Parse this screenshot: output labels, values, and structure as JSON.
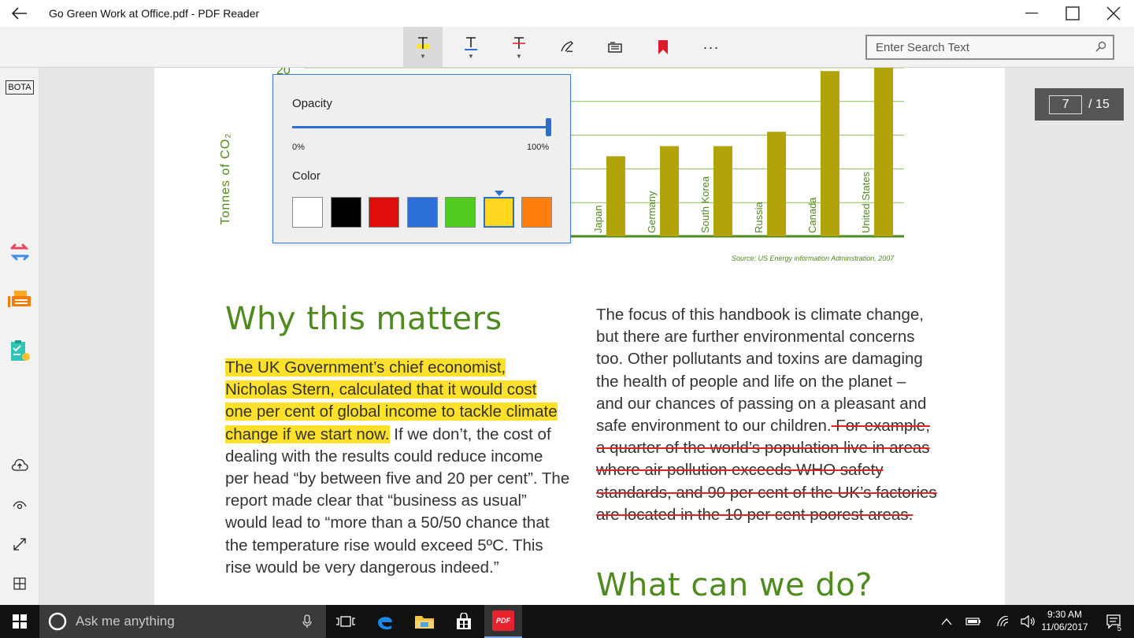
{
  "window": {
    "title": "Go Green Work at Office.pdf - PDF Reader",
    "back_icon": "arrow-left-icon",
    "minimize_icon": "minimize-icon",
    "maximize_icon": "maximize-icon",
    "close_icon": "close-icon"
  },
  "toolbar": {
    "tools": [
      "highlight-text-icon",
      "underline-text-icon",
      "strikeout-text-icon",
      "freehand-pen-icon",
      "stamp-icon",
      "bookmark-icon",
      "more-icon"
    ],
    "search_placeholder": "Enter Search Text"
  },
  "sidebar": {
    "bota_label": "BOTA",
    "items": [
      "convert-icon",
      "fax-icon",
      "clipboard-check-icon",
      "cloud-upload-icon",
      "eye-icon",
      "expand-icon",
      "grid-icon"
    ]
  },
  "page_indicator": {
    "current": "7",
    "total": "/ 15"
  },
  "chart": {
    "ylabel": "Tonnes of CO₂",
    "y_tick_top": "20",
    "source": "Source: US Energy information Adminstration, 2007"
  },
  "chart_data": {
    "type": "bar",
    "categories": [
      "Japan",
      "Germany",
      "South Korea",
      "Russia",
      "Canada",
      "United States"
    ],
    "values": [
      9.5,
      10.7,
      10.7,
      12.4,
      19.6,
      20.1
    ],
    "ylim": [
      0,
      20
    ],
    "ylabel": "Tonnes of CO₂",
    "grid": true
  },
  "popup": {
    "opacity_label": "Opacity",
    "opacity_value": 1.0,
    "min_label": "0%",
    "max_label": "100%",
    "color_label": "Color",
    "colors": [
      "#ffffff",
      "#000000",
      "#e00d0d",
      "#2c6fd6",
      "#52cc1e",
      "#ffd620",
      "#ff7f0e"
    ],
    "selected_color": "#ffd620"
  },
  "content": {
    "heading1": "Why this matters",
    "left_highlight_1": "The UK Government’s chief economist,",
    "left_highlight_2": "Nicholas Stern, calculated that it would cost",
    "left_highlight_3": "one per cent of global income to tackle climate",
    "left_highlight_4": "change if we start now.",
    "left_rest_4": " If we don’t, the cost of",
    "left_5": "dealing with the results could reduce income",
    "left_6": "per head “by between five and 20 per cent”. The",
    "left_7": "report made clear that “business as usual”",
    "left_8": "would lead to “more than a 50/50 chance that",
    "left_9": "the temperature rise would exceed 5ºC. This",
    "left_10": "rise would be very dangerous indeed.”",
    "right_1": "The focus of this handbook is climate change,",
    "right_2": "but there are further environmental concerns",
    "right_3": "too. Other pollutants and toxins are damaging",
    "right_4": "the health of people and life on the planet –",
    "right_5": "and our chances of passing on a pleasant and",
    "right_6": "safe environment to our children.",
    "right_strike_6": " For example,",
    "right_strike_7": "a quarter of the world’s population live in areas",
    "right_strike_8": "where air pollution exceeds WHO safety",
    "right_strike_9": "standards, and 90 per cent of the UK’s factories",
    "right_strike_10": "are located in the 10 per cent poorest areas.",
    "heading2": "What can we do?"
  },
  "taskbar": {
    "search_text": "Ask me anything",
    "time": "9:30 AM",
    "date": "11/06/2017",
    "notification_count": "5",
    "pdf_label": "PDF"
  }
}
